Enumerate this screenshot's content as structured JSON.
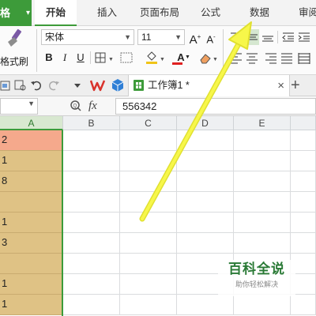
{
  "app_menu": {
    "label": "格"
  },
  "tabs": [
    {
      "label": "开始",
      "active": true
    },
    {
      "label": "插入"
    },
    {
      "label": "页面布局"
    },
    {
      "label": "公式"
    },
    {
      "label": "数据"
    },
    {
      "label": "审阅"
    }
  ],
  "ribbon": {
    "format_painter_label": "格式刷",
    "font_name": "宋体",
    "font_size": "11",
    "buttons": {
      "bold": "B",
      "italic": "I",
      "underline": "U",
      "grow_font": "A",
      "shrink_font": "A",
      "font_color": "A"
    }
  },
  "document": {
    "tab_title": "工作簿1 *",
    "close": "×",
    "new": "+"
  },
  "formula_bar": {
    "fx": "fx",
    "value": "556342"
  },
  "grid": {
    "columns": [
      "A",
      "B",
      "C",
      "D",
      "E"
    ],
    "column_a_values": [
      "2",
      "1",
      "8",
      "",
      "1",
      "3",
      "",
      "1",
      "1"
    ]
  },
  "watermark": {
    "title": "百科全说",
    "subtitle": "助你轻松解决"
  },
  "colors": {
    "accent": "#3d9b3a",
    "selection_fill": "#dfc285",
    "first_cell_fill": "#f5a98c",
    "arrow": "#f5f53a"
  }
}
